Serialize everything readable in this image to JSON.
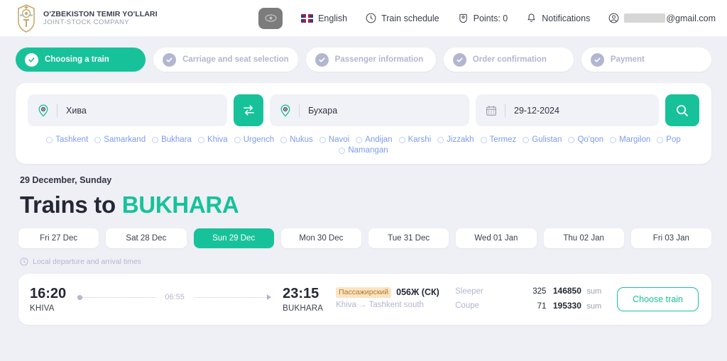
{
  "header": {
    "brand_line1": "O'ZBEKISTON TEMIR YO'LLARI",
    "brand_line2": "JOINT-STOCK COMPANY",
    "logo_icon": "railway-emblem-icon",
    "accessibility_icon": "eye-icon",
    "language": "English",
    "language_flag_icon": "uk-flag-icon",
    "train_schedule": "Train schedule",
    "train_schedule_icon": "clock-icon",
    "points": "Points: 0",
    "points_icon": "ticket-icon",
    "notifications": "Notifications",
    "notifications_icon": "bell-icon",
    "account_icon": "user-circle-icon",
    "email_suffix": "@gmail.com"
  },
  "stepper": {
    "steps": [
      {
        "label": "Choosing a train",
        "active": true
      },
      {
        "label": "Carriage and seat selection",
        "active": false
      },
      {
        "label": "Passenger information",
        "active": false
      },
      {
        "label": "Order confirmation",
        "active": false
      },
      {
        "label": "Payment",
        "active": false
      }
    ]
  },
  "search": {
    "from_value": "Хива",
    "from_icon": "location-pin-icon",
    "to_value": "Бухара",
    "to_icon": "location-pin-icon",
    "date_value": "29-12-2024",
    "date_icon": "calendar-icon",
    "swap_icon": "swap-arrows-icon",
    "search_icon": "search-icon",
    "cities": [
      "Tashkent",
      "Samarkand",
      "Bukhara",
      "Khiva",
      "Urgench",
      "Nukus",
      "Navoi",
      "Andijan",
      "Karshi",
      "Jizzakh",
      "Termez",
      "Gulistan",
      "Qo'qon",
      "Margilon",
      "Pop",
      "Namangan"
    ]
  },
  "results": {
    "date_line": "29 December, Sunday",
    "title_prefix": "Trains to",
    "title_destination": "BUKHARA",
    "local_note": "Local departure and arrival times",
    "local_note_icon": "clock-icon",
    "date_tabs": [
      {
        "label": "Fri 27 Dec",
        "selected": false
      },
      {
        "label": "Sat 28 Dec",
        "selected": false
      },
      {
        "label": "Sun 29 Dec",
        "selected": true
      },
      {
        "label": "Mon 30 Dec",
        "selected": false
      },
      {
        "label": "Tue 31 Dec",
        "selected": false
      },
      {
        "label": "Wed 01 Jan",
        "selected": false
      },
      {
        "label": "Thu 02 Jan",
        "selected": false
      },
      {
        "label": "Fri 03 Jan",
        "selected": false
      }
    ],
    "train": {
      "depart_time": "16:20",
      "depart_city": "KHIVA",
      "duration": "06:55",
      "arrive_time": "23:15",
      "arrive_city": "BUKHARA",
      "type_badge": "Пассажирский",
      "train_number": "056Ж (СК)",
      "full_route": "Khiva → Tashkent south",
      "classes": [
        {
          "name": "Sleeper",
          "seats": "325",
          "price": "146850",
          "currency": "sum"
        },
        {
          "name": "Coupe",
          "seats": "71",
          "price": "195330",
          "currency": "sum"
        }
      ],
      "choose_label": "Choose train"
    }
  },
  "colors": {
    "accent": "#17c29a",
    "page_bg": "#eef0f5",
    "muted": "#b3b6d0",
    "badge_bg": "#fbe4c3",
    "badge_text": "#b07a2a",
    "city_link": "#7d9cf0"
  }
}
